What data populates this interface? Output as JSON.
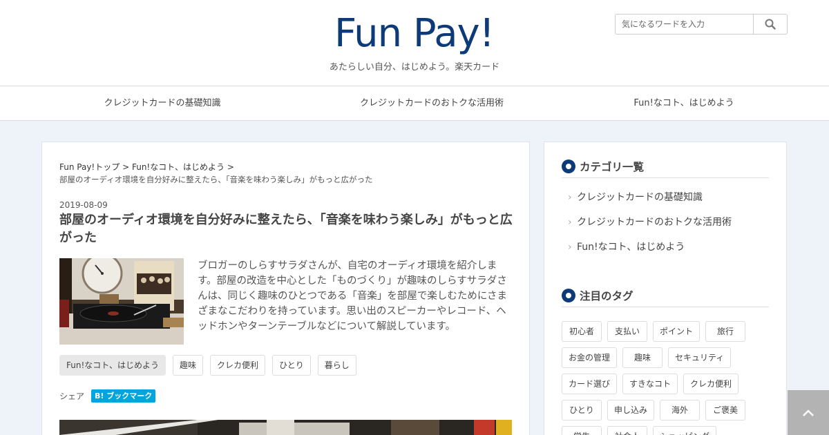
{
  "header": {
    "logo": "Fun Pay!",
    "tagline": "あたらしい自分、はじめよう。楽天カード",
    "search": {
      "placeholder": "気になるワードを入力",
      "button_icon": "search-icon"
    }
  },
  "nav": {
    "items": [
      {
        "label": "クレジットカードの基礎知識"
      },
      {
        "label": "クレジットカードのおトクな活用術"
      },
      {
        "label": "Fun!なコト、はじめよう"
      }
    ]
  },
  "breadcrumb": {
    "items": [
      "Fun Pay!トップ",
      "Fun!なコト、はじめよう"
    ],
    "separator": ">",
    "current": "部屋のオーディオ環境を自分好みに整えたら、「音楽を味わう楽しみ」がもっと広がった"
  },
  "article": {
    "date": "2019-08-09",
    "title": "部屋のオーディオ環境を自分好みに整えたら、「音楽を味わう楽しみ」がもっと広がった",
    "excerpt": "ブロガーのしらすサラダさんが、自宅のオーディオ環境を紹介します。部屋の改造を中心とした「ものづくり」が趣味のしらすサラダさんは、同じく趣味のひとつである「音楽」を部屋で楽しむためにさまざまなこだわりを持っています。思い出のスピーカーやレコード、ヘッドホンやターンテーブルなどについて解説しています。",
    "tags": [
      "Fun!なコト、はじめよう",
      "趣味",
      "クレカ便利",
      "ひとり",
      "暮らし"
    ],
    "share_label": "シェア",
    "hatena_label": "B! ブックマーク"
  },
  "sidebar": {
    "categories": {
      "title": "カテゴリ一覧",
      "items": [
        "クレジットカードの基礎知識",
        "クレジットカードのおトクな活用術",
        "Fun!なコト、はじめよう"
      ]
    },
    "tags": {
      "title": "注目のタグ",
      "items": [
        "初心者",
        "支払い",
        "ポイント",
        "旅行",
        "お金の管理",
        "趣味",
        "セキュリティ",
        "カード選び",
        "すきなコト",
        "クレカ便利",
        "ひとり",
        "申し込み",
        "海外",
        "ご褒美",
        "学生",
        "社会人",
        "ショッピング"
      ]
    }
  },
  "colors": {
    "brand": "#0d3a78",
    "hatena": "#00a4de",
    "background": "#eef3fa",
    "to_top": "#b3b3b3"
  }
}
